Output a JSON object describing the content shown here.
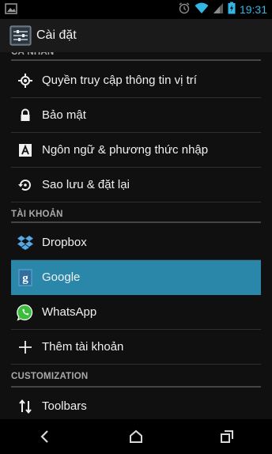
{
  "status_bar": {
    "time": "19:31",
    "icons": [
      "image-notification-icon",
      "alarm-icon",
      "wifi-icon",
      "signal-icon",
      "battery-charging-icon"
    ]
  },
  "action_bar": {
    "title": "Cài đặt",
    "icon": "settings-app-icon"
  },
  "sections": [
    {
      "header": "CÁ NHÂN",
      "items": [
        {
          "label": "Quyền truy cập thông tin vị trí",
          "icon": "location-icon"
        },
        {
          "label": "Bảo mật",
          "icon": "lock-icon"
        },
        {
          "label": "Ngôn ngữ & phương thức nhập",
          "icon": "keyboard-a-icon"
        },
        {
          "label": "Sao lưu & đặt lại",
          "icon": "backup-restore-icon"
        }
      ]
    },
    {
      "header": "TÀI KHOẢN",
      "items": [
        {
          "label": "Dropbox",
          "icon": "dropbox-icon"
        },
        {
          "label": "Google",
          "icon": "google-g-icon",
          "selected": true
        },
        {
          "label": "WhatsApp",
          "icon": "whatsapp-icon"
        },
        {
          "label": "Thêm tài khoản",
          "icon": "add-icon"
        }
      ]
    },
    {
      "header": "CUSTOMIZATION",
      "items": [
        {
          "label": "Toolbars",
          "icon": "toolbars-icon"
        }
      ]
    }
  ],
  "nav_bar": {
    "buttons": [
      "back-icon",
      "home-icon",
      "recent-apps-icon"
    ]
  },
  "colors": {
    "accent": "#33b5e5",
    "selected_row": "#2b87aa",
    "background": "#101010"
  }
}
